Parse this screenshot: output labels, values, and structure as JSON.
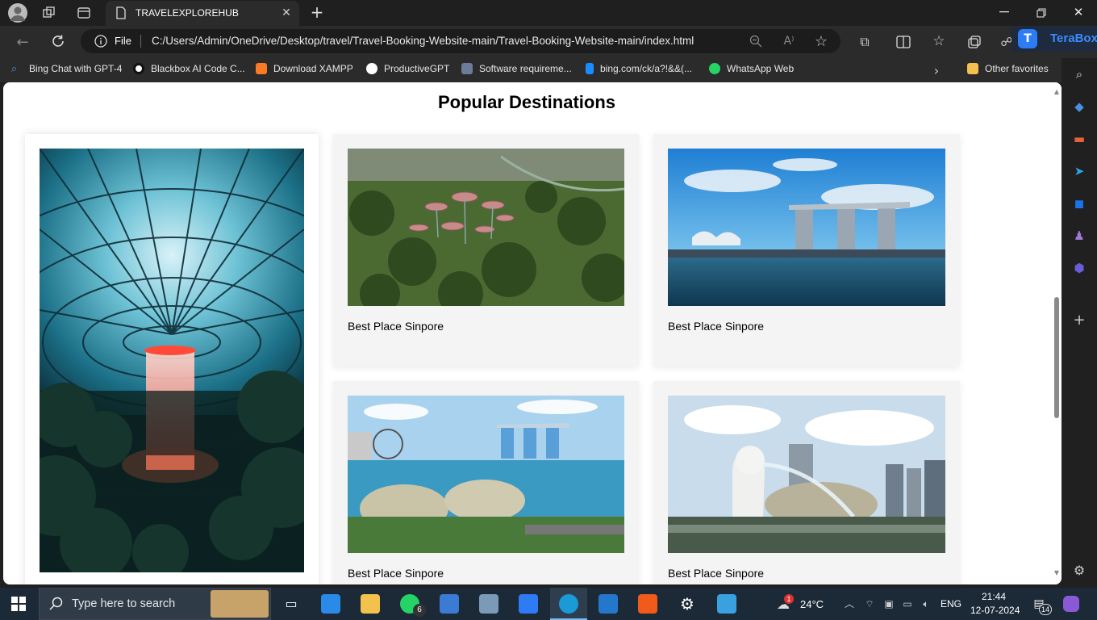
{
  "browser": {
    "tab_title": "TRAVELEXPLOREHUB",
    "address_scheme": "File",
    "address_url": "C:/Users/Admin/OneDrive/Desktop/travel/Travel-Booking-Website-main/Travel-Booking-Website-main/index.html",
    "extension_label": "TeraBox"
  },
  "favorites": [
    {
      "label": "Bing Chat with GPT-4",
      "icon": "search-icon",
      "color": "#4a90e2"
    },
    {
      "label": "Blackbox AI Code C...",
      "icon": "blackbox-icon",
      "color": "#111111"
    },
    {
      "label": "Download XAMPP",
      "icon": "xampp-icon",
      "color": "#fb7a24"
    },
    {
      "label": "ProductiveGPT",
      "icon": "triangle-icon",
      "color": "#000000"
    },
    {
      "label": "Software requireme...",
      "icon": "doc-icon",
      "color": "#6b7b99"
    },
    {
      "label": "bing.com/ck/a?!&&(...",
      "icon": "bing-icon",
      "color": "#1a8cff"
    },
    {
      "label": "WhatsApp Web",
      "icon": "whatsapp-icon",
      "color": "#25d366"
    }
  ],
  "other_favorites": "Other favorites",
  "page": {
    "title": "Popular Destinations",
    "cards": [
      {
        "caption": "Best Place Sinpore",
        "image": "gardens-by-the-bay"
      },
      {
        "caption": "Best Place Sinpore",
        "image": "marina-bay-sands"
      },
      {
        "caption": "Best Place Sinpore",
        "image": "esplanade-skyline"
      },
      {
        "caption": "Best Place Sinpore",
        "image": "merlion"
      }
    ]
  },
  "taskbar": {
    "search_placeholder": "Type here to search",
    "whatsapp_badge": "6",
    "weather_temp": "24°C",
    "weather_badge": "1",
    "language": "ENG",
    "time": "21:44",
    "date": "12-07-2024",
    "notification_count": "14"
  }
}
